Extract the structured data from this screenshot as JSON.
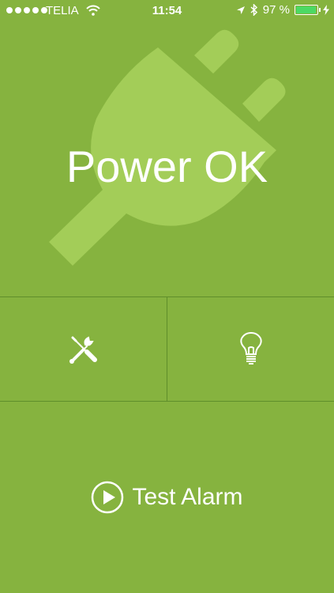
{
  "status_bar": {
    "carrier": "TELIA",
    "time": "11:54",
    "battery_percent": "97 %",
    "battery_level": 0.97,
    "icons": [
      "signal-icon",
      "wifi-icon",
      "location-arrow-icon",
      "bluetooth-icon",
      "battery-icon",
      "charging-bolt-icon"
    ]
  },
  "main": {
    "status_text": "Power OK",
    "background_icon": "plug-icon"
  },
  "tiles": {
    "settings_icon": "tools-icon",
    "light_icon": "lightbulb-icon"
  },
  "actions": {
    "test_alarm_label": "Test Alarm",
    "test_alarm_icon": "play-circle-icon"
  },
  "colors": {
    "background": "#86b33f",
    "plug": "#a3cd58",
    "divider": "#5f8e2b",
    "battery_fill": "#4cd964"
  }
}
